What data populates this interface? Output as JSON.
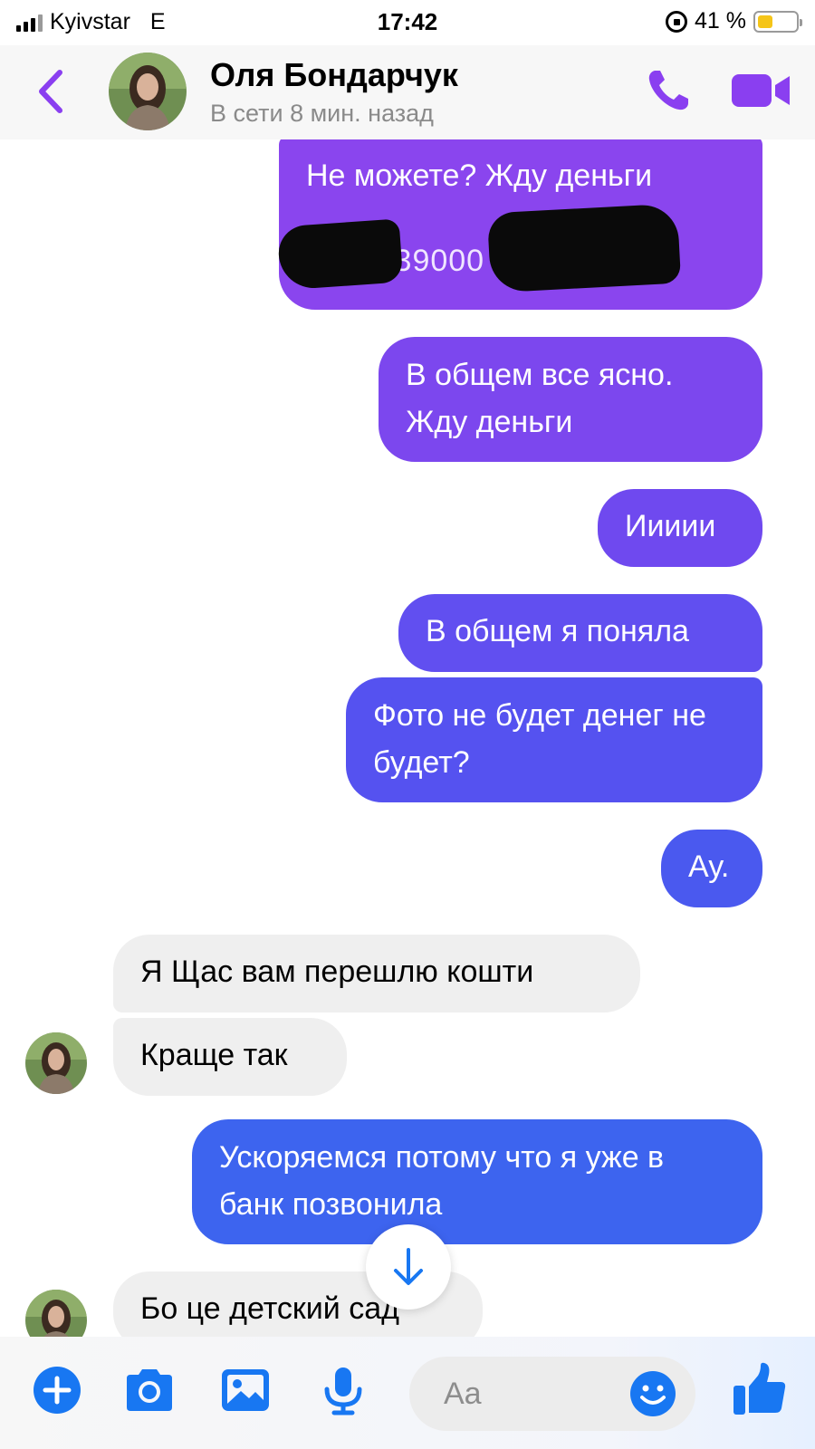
{
  "status_bar": {
    "carrier": "Kyivstar",
    "network": "E",
    "time": "17:42",
    "battery": "41 %",
    "battery_level": 0.41
  },
  "header": {
    "contact_name": "Оля Бондарчук",
    "contact_status": "В сети 8 мин. назад",
    "icons": [
      "back-icon",
      "avatar",
      "phone-icon",
      "video-camera-icon"
    ],
    "accent_color": "#8a3ff0"
  },
  "messages": [
    {
      "direction": "outgoing",
      "text": "Не можете? Жду деньги",
      "text2": "4149439000"
    },
    {
      "direction": "outgoing",
      "text": "В общем все ясно. Жду деньги"
    },
    {
      "direction": "outgoing",
      "text": "Иииии"
    },
    {
      "direction": "outgoing",
      "text": "В общем я поняла"
    },
    {
      "direction": "outgoing",
      "text": "Фото не будет денег не будет?"
    },
    {
      "direction": "outgoing",
      "text": "Ау."
    },
    {
      "direction": "incoming",
      "text": "Я Щас вам перешлю кошти"
    },
    {
      "direction": "incoming",
      "text": "Краще так"
    },
    {
      "direction": "outgoing",
      "text": "Ускоряемся потому что я уже в банк позвонила"
    },
    {
      "direction": "incoming",
      "text": "Бо це детский сад"
    }
  ],
  "composer": {
    "placeholder": "Aa",
    "icons": [
      "plus-icon",
      "camera-icon",
      "gallery-icon",
      "microphone-icon",
      "emoji-icon",
      "thumbs-up-icon"
    ],
    "icon_color": "#1877f2"
  }
}
